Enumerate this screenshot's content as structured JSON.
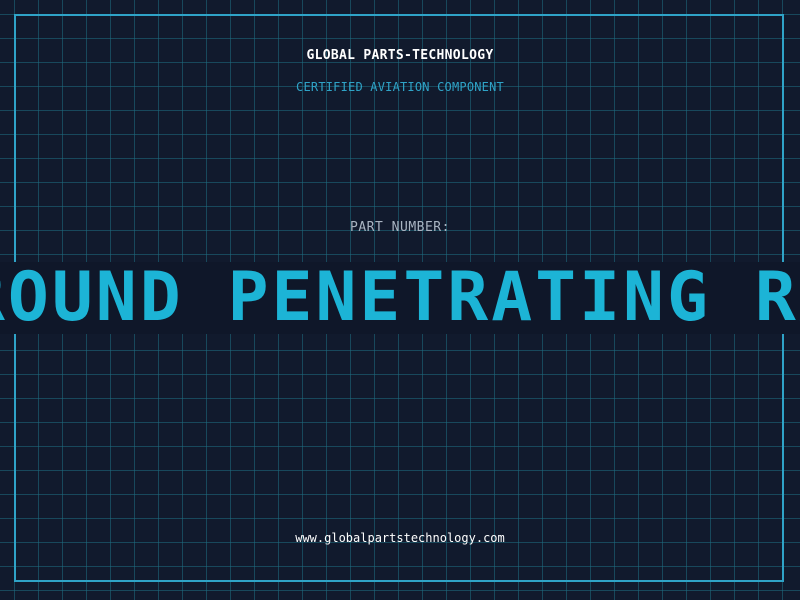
{
  "header": {
    "company": "GLOBAL PARTS-TECHNOLOGY",
    "subtitle": "CERTIFIED AVIATION COMPONENT"
  },
  "part": {
    "label": "PART NUMBER:",
    "name": "GROUND PENETRATING RADAR SYSTEM"
  },
  "footer": {
    "website": "www.globalpartstechnology.com"
  },
  "colors": {
    "background": "#111a2d",
    "grid": "#1e6e82",
    "frame": "#2fa3c7",
    "accent": "#1cb4d6",
    "label": "#a9b4c2",
    "text": "#ffffff"
  }
}
